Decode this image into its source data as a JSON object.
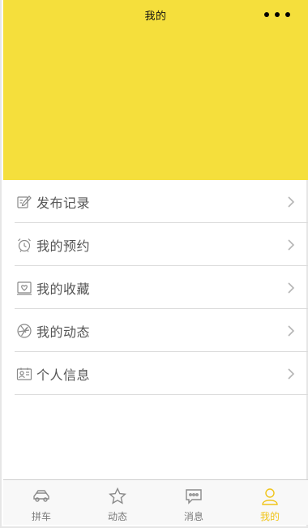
{
  "nav": {
    "title": "我的"
  },
  "menu": {
    "items": [
      {
        "label": "发布记录",
        "icon": "edit-icon"
      },
      {
        "label": "我的预约",
        "icon": "alarm-clock-icon"
      },
      {
        "label": "我的收藏",
        "icon": "favorite-box-icon"
      },
      {
        "label": "我的动态",
        "icon": "aperture-icon"
      },
      {
        "label": "个人信息",
        "icon": "id-card-icon"
      }
    ]
  },
  "tabbar": {
    "tabs": [
      {
        "label": "拼车",
        "icon": "car-icon",
        "active": false
      },
      {
        "label": "动态",
        "icon": "star-icon",
        "active": false
      },
      {
        "label": "消息",
        "icon": "chat-icon",
        "active": false
      },
      {
        "label": "我的",
        "icon": "user-icon",
        "active": true
      }
    ]
  },
  "colors": {
    "header_bg": "#f5df3c",
    "active_tab": "#f0c419",
    "inactive_tab": "#7a7a7a"
  }
}
